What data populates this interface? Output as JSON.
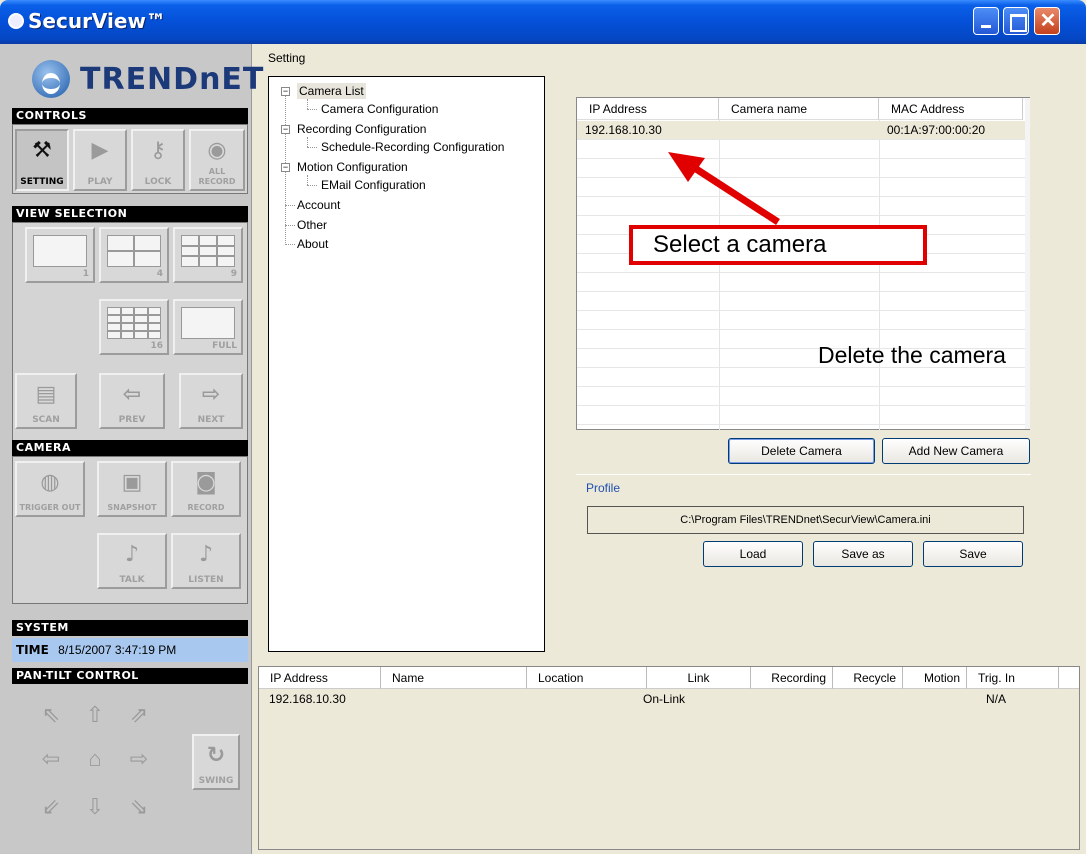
{
  "window": {
    "title": "SecurView™"
  },
  "brand": {
    "logo_text": "TRENDnET"
  },
  "controls": {
    "header": "CONTROLS",
    "buttons": [
      {
        "label": "SETTING",
        "icon": "wrench-icon",
        "active": true
      },
      {
        "label": "PLAY",
        "icon": "play-icon",
        "active": false
      },
      {
        "label": "LOCK",
        "icon": "key-icon",
        "active": false
      },
      {
        "label": "ALL RECORD",
        "icon": "cameras-icon",
        "active": false
      }
    ]
  },
  "view_selection": {
    "header": "VIEW SELECTION",
    "buttons": [
      {
        "label": "1"
      },
      {
        "label": "4"
      },
      {
        "label": "9"
      },
      {
        "label": "16"
      },
      {
        "label": "FULL"
      },
      {
        "label": "SCAN"
      },
      {
        "label": "PREV"
      },
      {
        "label": "NEXT"
      }
    ]
  },
  "camera": {
    "header": "CAMERA",
    "buttons": [
      {
        "label": "TRIGGER OUT"
      },
      {
        "label": "SNAPSHOT"
      },
      {
        "label": "RECORD"
      },
      {
        "label": "TALK"
      },
      {
        "label": "LISTEN"
      }
    ]
  },
  "system": {
    "header": "SYSTEM",
    "time_label": "TIME",
    "time_value": "8/15/2007 3:47:19 PM"
  },
  "pan_tilt": {
    "header": "PAN-TILT CONTROL",
    "swing_label": "SWING"
  },
  "setting": {
    "label": "Setting",
    "tree": [
      {
        "label": "Camera List",
        "expander": "−",
        "selected": true
      },
      {
        "label": "Camera Configuration"
      },
      {
        "label": "Recording Configuration",
        "expander": "−"
      },
      {
        "label": "Schedule-Recording Configuration"
      },
      {
        "label": "Motion Configuration",
        "expander": "−"
      },
      {
        "label": "EMail Configuration"
      },
      {
        "label": "Account"
      },
      {
        "label": "Other"
      },
      {
        "label": "About"
      }
    ]
  },
  "camera_list": {
    "columns": [
      "IP Address",
      "Camera name",
      "MAC Address"
    ],
    "rows": [
      {
        "ip": "192.168.10.30",
        "name": "",
        "mac": "00:1A:97:00:00:20"
      }
    ]
  },
  "buttons": {
    "delete_camera": "Delete Camera",
    "add_new_camera": "Add New Camera",
    "load": "Load",
    "save_as": "Save as",
    "save": "Save"
  },
  "profile": {
    "label": "Profile",
    "path": "C:\\Program Files\\TRENDnet\\SecurView\\Camera.ini"
  },
  "annotations": {
    "select_camera": "Select a camera",
    "delete_camera": "Delete the camera",
    "arrow_color": "#e00000"
  },
  "status_list": {
    "columns": [
      "IP Address",
      "Name",
      "Location",
      "Link",
      "Recording",
      "Recycle",
      "Motion",
      "Trig. In"
    ],
    "rows": [
      {
        "ip": "192.168.10.30",
        "name": "",
        "location": "",
        "link": "On-Link",
        "recording": "",
        "recycle": "",
        "motion": "",
        "trig_in": "N/A"
      }
    ]
  }
}
